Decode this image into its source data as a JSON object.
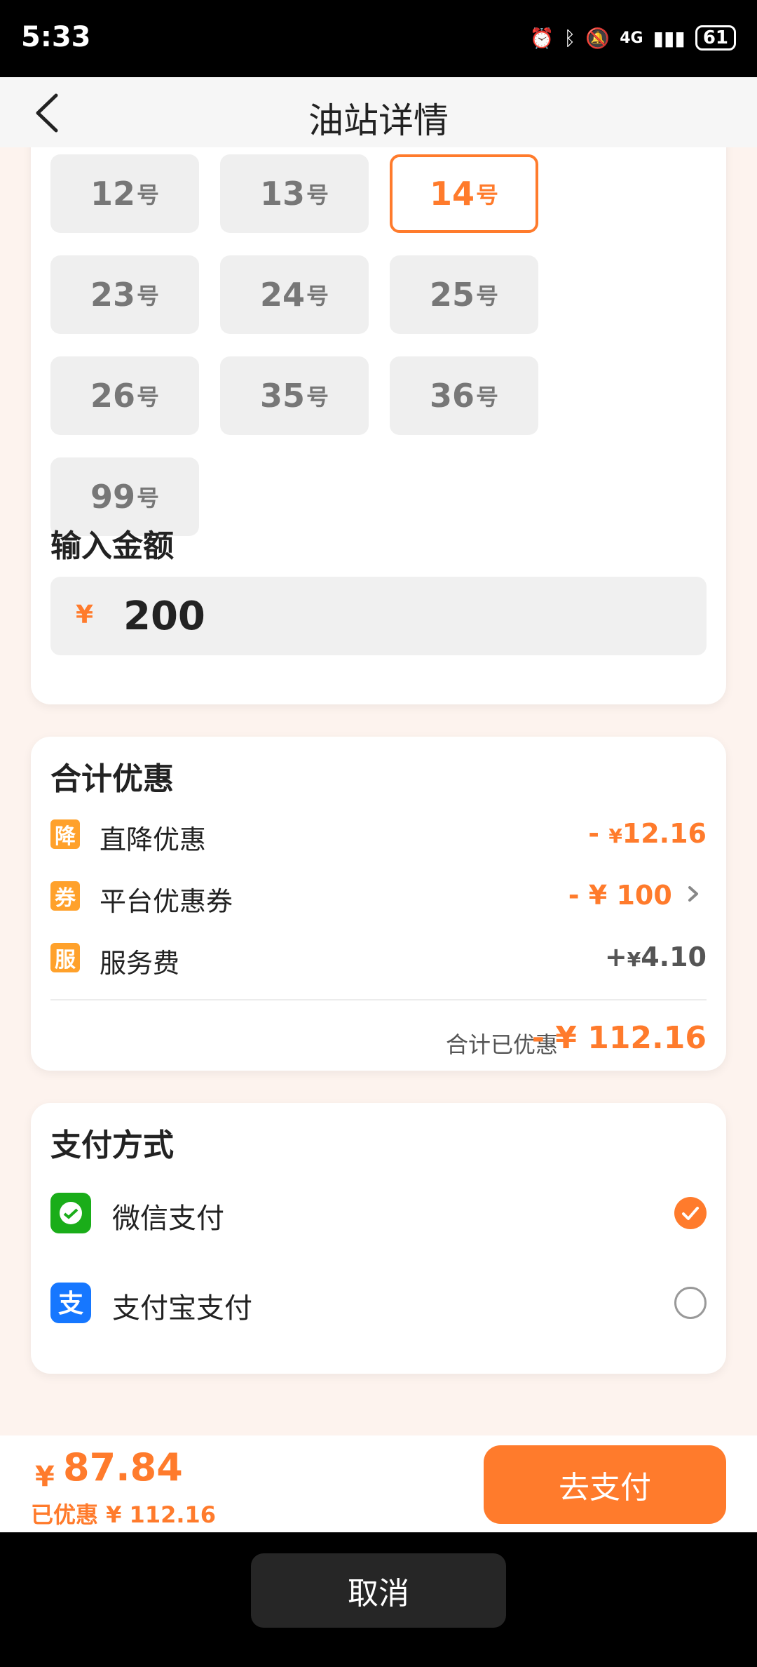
{
  "status": {
    "time": "5:33",
    "network": "4G",
    "battery": "61"
  },
  "header": {
    "title": "油站详情"
  },
  "nozzles": [
    {
      "num": "12",
      "unit": "号",
      "selected": false
    },
    {
      "num": "13",
      "unit": "号",
      "selected": false
    },
    {
      "num": "14",
      "unit": "号",
      "selected": true
    },
    {
      "num": "23",
      "unit": "号",
      "selected": false
    },
    {
      "num": "24",
      "unit": "号",
      "selected": false
    },
    {
      "num": "25",
      "unit": "号",
      "selected": false
    },
    {
      "num": "26",
      "unit": "号",
      "selected": false
    },
    {
      "num": "35",
      "unit": "号",
      "selected": false
    },
    {
      "num": "36",
      "unit": "号",
      "selected": false
    },
    {
      "num": "99",
      "unit": "号",
      "selected": false
    }
  ],
  "amount": {
    "label": "输入金额",
    "currency": "¥",
    "value": "200"
  },
  "discount": {
    "title": "合计优惠",
    "rows": [
      {
        "badge": "降",
        "label": "直降优惠",
        "sign": "-",
        "yen": "¥",
        "amount": "12.16"
      },
      {
        "badge": "券",
        "label": "平台优惠券",
        "sign": "-",
        "yen": "¥",
        "amount": "100"
      },
      {
        "badge": "服",
        "label": "服务费",
        "sign": "+",
        "yen": "¥",
        "amount": "4.10"
      }
    ],
    "total_label": "合计已优惠",
    "total_value": "- ¥ 112.16"
  },
  "payment": {
    "title": "支付方式",
    "methods": [
      {
        "label": "微信支付",
        "selected": true,
        "icon": "wechat-pay-icon"
      },
      {
        "label": "支付宝支付",
        "selected": false,
        "icon": "alipay-icon"
      }
    ]
  },
  "bottom": {
    "currency": "¥",
    "total": "87.84",
    "saved": "已优惠 ¥ 112.16",
    "pay_label": "去支付"
  },
  "cancel_label": "取消",
  "colors": {
    "accent": "#ff7b2c",
    "badge": "#ffa12b",
    "wechat": "#1aad19",
    "alipay": "#1677ff"
  }
}
